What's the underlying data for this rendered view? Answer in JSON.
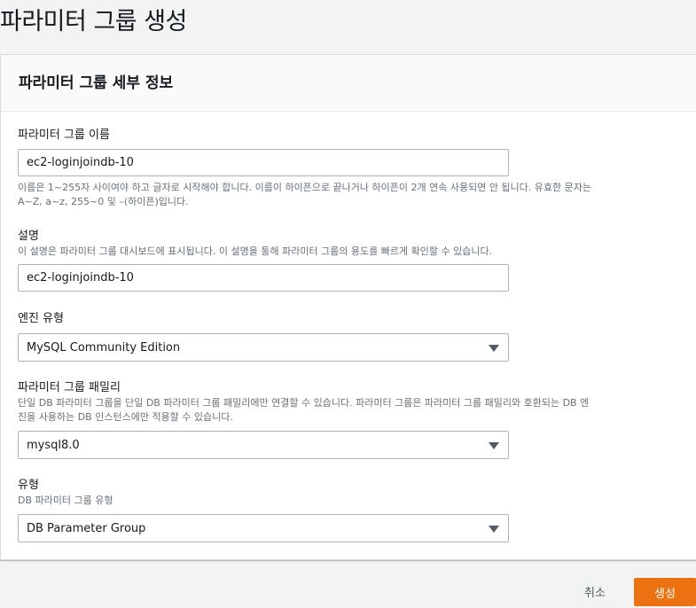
{
  "page_title": "파라미터 그룹 생성",
  "panel": {
    "title": "파라미터 그룹 세부 정보"
  },
  "fields": {
    "group_name": {
      "label": "파라미터 그룹 이름",
      "value": "ec2-loginjoindb-10",
      "help_line1": "이름은 1~255자 사이여야 하고 글자로 시작해야 합니다. 이름이 하이픈으로 끝나거나 하이픈이 2개 연속 사용되면 안 됩니다. 유효한 문자는",
      "help_line2": "A~Z, a~z, 255~0 및 –(하이픈)입니다."
    },
    "description": {
      "label": "설명",
      "help": "이 설명은 파라미터 그룹 대시보드에 표시됩니다. 이 설명을 통해 파라미터 그룹의 용도를 빠르게 확인할 수 있습니다.",
      "value": "ec2-loginjoindb-10"
    },
    "engine_type": {
      "label": "엔진 유형",
      "selected": "MySQL Community Edition"
    },
    "family": {
      "label": "파라미터 그룹 패밀리",
      "help_line1": "단일 DB 파라미터 그룹을 단일 DB 파라미터 그룹 패밀리에만 연결할 수 있습니다. 파라미터 그룹은 파라미터 그룹 패밀리와 호환되는 DB 엔",
      "help_line2": "진을 사용하는 DB 인스턴스에만 적용할 수 있습니다.",
      "selected": "mysql8.0"
    },
    "type": {
      "label": "유형",
      "help": "DB 파라미터 그룹 유형",
      "selected": "DB Parameter Group"
    }
  },
  "actions": {
    "cancel": "취소",
    "create": "생성"
  },
  "colors": {
    "primary_button": "#ec7211",
    "background": "#f2f3f3",
    "border": "#aab7b8"
  },
  "icons": {
    "dropdown": "caret-down-icon"
  }
}
